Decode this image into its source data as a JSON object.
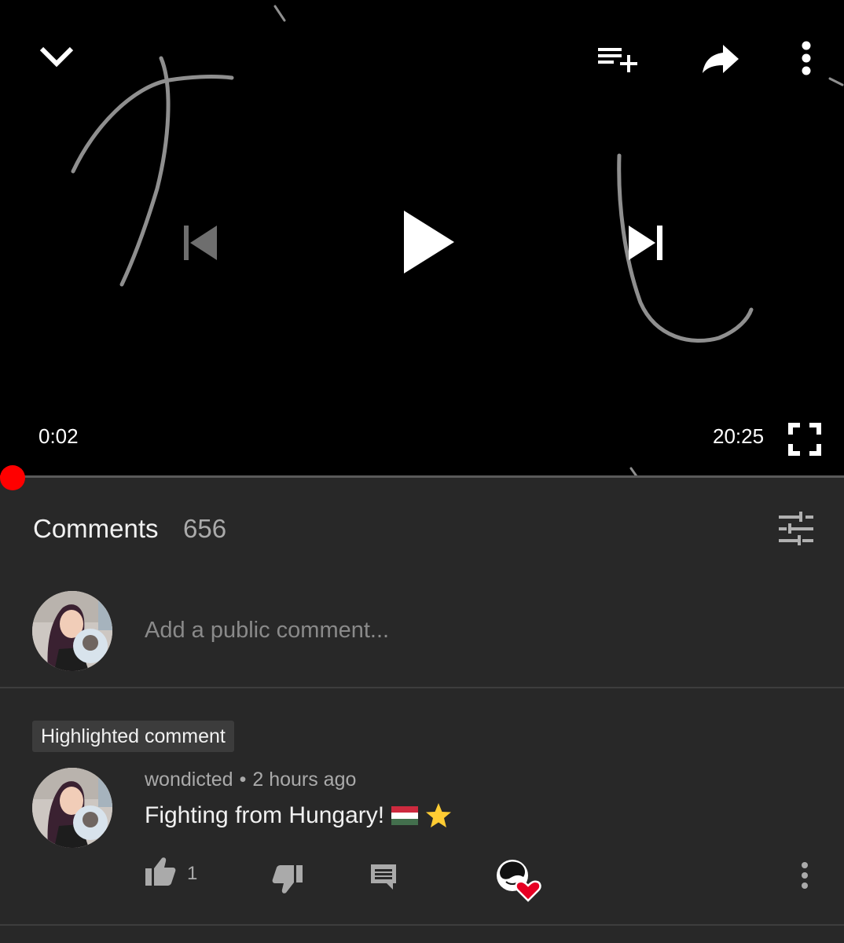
{
  "player": {
    "current_time": "0:02",
    "duration": "20:25",
    "progress": 0.0016
  },
  "icons": {
    "collapse": "chevron-down-icon",
    "add_to_queue": "playlist-add-icon",
    "share": "share-icon",
    "more": "more-vert-icon",
    "previous": "skip-previous-icon",
    "play": "play-icon",
    "next": "skip-next-icon",
    "fullscreen": "fullscreen-icon",
    "sort": "sort-filter-icon",
    "like": "thumb-up-icon",
    "dislike": "thumb-down-icon",
    "reply": "reply-comment-icon",
    "creator_heart": "creator-heart-icon",
    "comment_more": "more-vert-icon"
  },
  "comments": {
    "title": "Comments",
    "count": "656",
    "add_placeholder": "Add a public comment..."
  },
  "highlighted": {
    "badge": "Highlighted comment",
    "author": "wondicted",
    "separator": "•",
    "time": "2 hours ago",
    "text": "Fighting from Hungary!",
    "likes": "1"
  },
  "colors": {
    "accent": "#ff0000",
    "background": "#282828",
    "player_bg": "#000000",
    "heart": "#e60023"
  }
}
